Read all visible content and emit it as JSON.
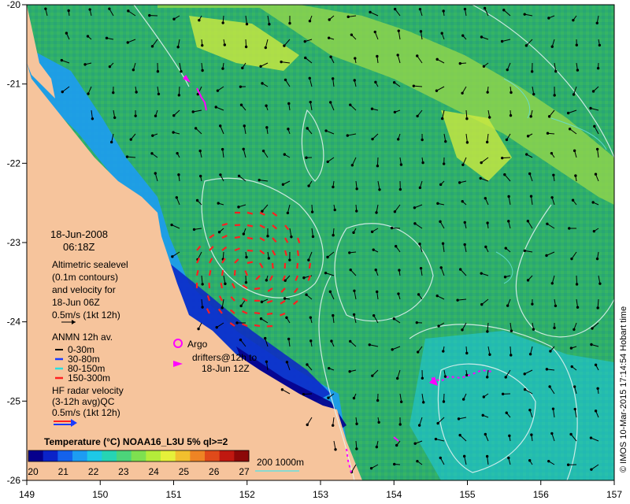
{
  "map": {
    "lon_ticks": [
      "149",
      "150",
      "151",
      "152",
      "153",
      "154",
      "155",
      "156",
      "157"
    ],
    "lat_ticks": [
      "-20",
      "-21",
      "-22",
      "-23",
      "-24",
      "-25",
      "-26"
    ],
    "date": "18-Jun-2008",
    "time": "06:18Z",
    "credit": "© IMOS 10-Mar-2015 17:14:54 Hobart time",
    "ocean_color": "#2bb070",
    "land_color": "#f6c49c"
  },
  "legend": {
    "altimetry": {
      "lines": [
        "Altimetric sealevel",
        "(0.1m contours)",
        "and velocity for",
        "18-Jun 06Z"
      ],
      "scale": "0.5m/s (1kt 12h)"
    },
    "anmn": {
      "title": "ANMN 12h av.",
      "items": [
        {
          "label": "0-30m",
          "color": "#000000"
        },
        {
          "label": "30-80m",
          "color": "#1a3cff"
        },
        {
          "label": "80-150m",
          "color": "#29e0e0"
        },
        {
          "label": "150-300m",
          "color": "#ff2020"
        }
      ]
    },
    "argo": {
      "label": "Argo",
      "color": "#ff00ff"
    },
    "drifters": {
      "lines": [
        "drifters@12h to",
        "18-Jun 12Z"
      ],
      "color": "#ff00ff"
    },
    "hf_radar": {
      "lines": [
        "HF radar velocity",
        "(3-12h avg)QC"
      ],
      "scale": "0.5m/s (1kt 12h)"
    }
  },
  "colorbar": {
    "title": "Temperature (°C) NOAA16_L3U 5% ql>=2",
    "ticks": [
      "20",
      "21",
      "22",
      "23",
      "24",
      "25",
      "26",
      "27"
    ],
    "colors": [
      "#06008c",
      "#0b23c8",
      "#1462ec",
      "#1d9cf2",
      "#1ec8e6",
      "#26d4b4",
      "#4cd47a",
      "#7ee050",
      "#b4ec3a",
      "#e6f03a",
      "#f2c02e",
      "#ee8424",
      "#e04a1a",
      "#c01810",
      "#8c0808"
    ]
  },
  "depth_legend": {
    "label": "200  1000m",
    "color": "#66e0e0"
  }
}
